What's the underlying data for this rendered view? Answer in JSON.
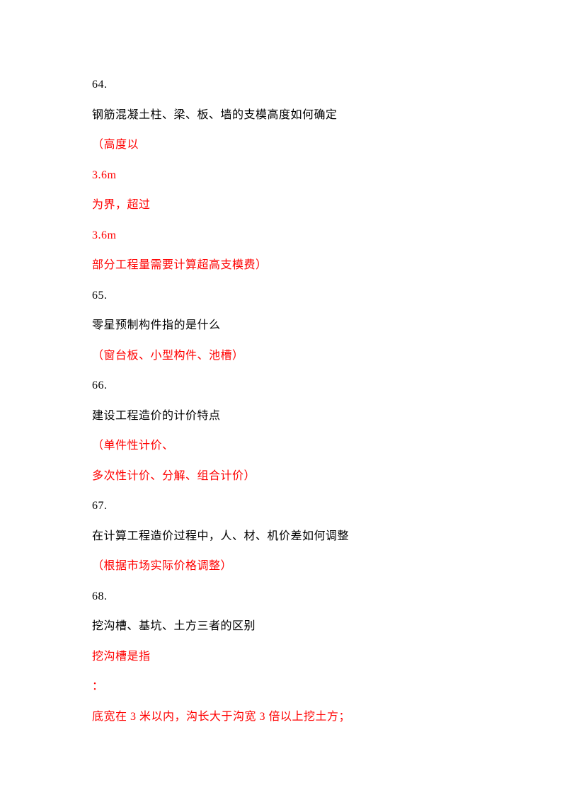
{
  "lines": [
    {
      "text": "64.",
      "red": false
    },
    {
      "text": "钢筋混凝土柱、梁、板、墙的支模高度如何确定",
      "red": false
    },
    {
      "text": "（高度以",
      "red": true
    },
    {
      "text": "3.6m",
      "red": true
    },
    {
      "text": "为界，超过",
      "red": true
    },
    {
      "text": "3.6m",
      "red": true
    },
    {
      "text": "部分工程量需要计算超高支模费）",
      "red": true
    },
    {
      "text": "65.",
      "red": false
    },
    {
      "text": "零星预制构件指的是什么",
      "red": false
    },
    {
      "text": "（窗台板、小型构件、池槽）",
      "red": true
    },
    {
      "text": "66.",
      "red": false
    },
    {
      "text": "建设工程造价的计价特点",
      "red": false
    },
    {
      "text": "（单件性计价、",
      "red": true
    },
    {
      "text": "多次性计价、分解、组合计价）",
      "red": true
    },
    {
      "text": "67.",
      "red": false
    },
    {
      "text": "在计算工程造价过程中，人、材、机价差如何调整",
      "red": false
    },
    {
      "text": "（根据市场实际价格调整）",
      "red": true
    },
    {
      "text": "68.",
      "red": false
    },
    {
      "text": "挖沟槽、基坑、土方三者的区别",
      "red": false
    },
    {
      "text": "挖沟槽是指",
      "red": true
    },
    {
      "text": "：",
      "red": true
    },
    {
      "text": "底宽在 3 米以内，沟长大于沟宽 3 倍以上挖土方；",
      "red": true
    }
  ]
}
